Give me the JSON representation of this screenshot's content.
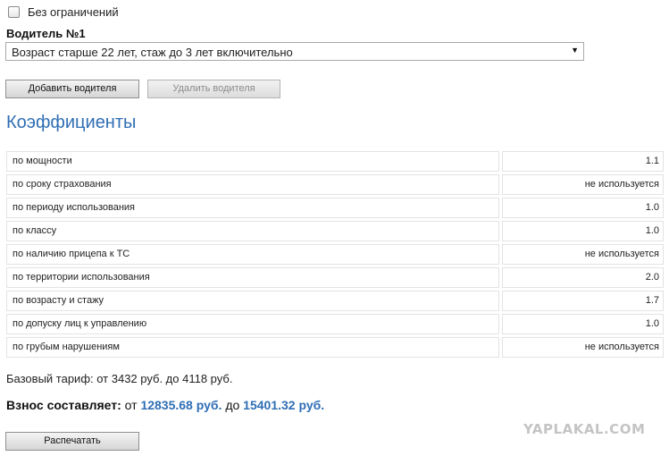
{
  "filter": {
    "no_limits_label": "Без ограничений",
    "checked": false
  },
  "driver": {
    "title": "Водитель №1",
    "age_select_value": "Возраст старше 22 лет, стаж до 3 лет включительно"
  },
  "buttons": {
    "add_driver": "Добавить водителя",
    "remove_driver": "Удалить водителя",
    "print": "Распечатать"
  },
  "coefficients": {
    "title": "Коэффициенты",
    "rows": [
      {
        "label": "по мощности",
        "value": "1.1"
      },
      {
        "label": "по сроку страхования",
        "value": "не используется"
      },
      {
        "label": "по периоду использования",
        "value": "1.0"
      },
      {
        "label": "по классу",
        "value": "1.0"
      },
      {
        "label": "по наличию прицепа к ТС",
        "value": "не используется"
      },
      {
        "label": "по территории использования",
        "value": "2.0"
      },
      {
        "label": "по возрасту и стажу",
        "value": "1.7"
      },
      {
        "label": "по допуску лиц к управлению",
        "value": "1.0"
      },
      {
        "label": "по грубым нарушениям",
        "value": "не используется"
      }
    ]
  },
  "summary": {
    "base_tariff": "Базовый тариф: от 3432 руб. до 4118 руб.",
    "premium_label": "Взнос составляет:",
    "from_word": "от",
    "premium_min": "12835.68 руб.",
    "to_word": "до",
    "premium_max": "15401.32 руб."
  },
  "watermark": "YAPLAKAL.COM",
  "colors": {
    "accent": "#2f6eb4"
  }
}
